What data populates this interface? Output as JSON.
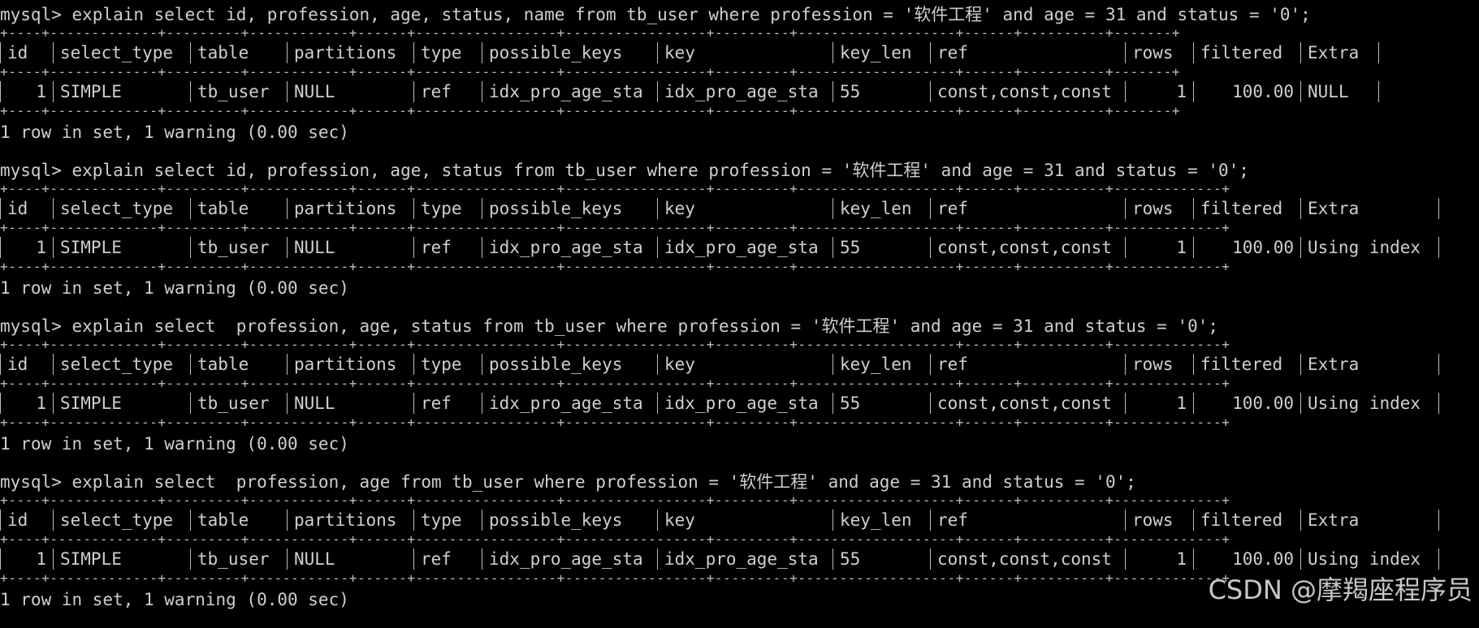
{
  "queries": [
    {
      "command": "mysql> explain select id, profession, age, status, name from tb_user where profession = '软件工程' and age = 31 and status = '0';",
      "headers": [
        "id",
        "select_type",
        "table",
        "partitions",
        "type",
        "possible_keys",
        "key",
        "key_len",
        "ref",
        "rows",
        "filtered",
        "Extra"
      ],
      "row": [
        "1",
        "SIMPLE",
        "tb_user",
        "NULL",
        "ref",
        "idx_pro_age_sta",
        "idx_pro_age_sta",
        "55",
        "const,const,const",
        "1",
        "100.00",
        "NULL"
      ],
      "status": "1 row in set, 1 warning (0.00 sec)"
    },
    {
      "command": "mysql> explain select id, profession, age, status from tb_user where profession = '软件工程' and age = 31 and status = '0';",
      "headers": [
        "id",
        "select_type",
        "table",
        "partitions",
        "type",
        "possible_keys",
        "key",
        "key_len",
        "ref",
        "rows",
        "filtered",
        "Extra"
      ],
      "row": [
        "1",
        "SIMPLE",
        "tb_user",
        "NULL",
        "ref",
        "idx_pro_age_sta",
        "idx_pro_age_sta",
        "55",
        "const,const,const",
        "1",
        "100.00",
        "Using index"
      ],
      "status": "1 row in set, 1 warning (0.00 sec)"
    },
    {
      "command": "mysql> explain select  profession, age, status from tb_user where profession = '软件工程' and age = 31 and status = '0';",
      "headers": [
        "id",
        "select_type",
        "table",
        "partitions",
        "type",
        "possible_keys",
        "key",
        "key_len",
        "ref",
        "rows",
        "filtered",
        "Extra"
      ],
      "row": [
        "1",
        "SIMPLE",
        "tb_user",
        "NULL",
        "ref",
        "idx_pro_age_sta",
        "idx_pro_age_sta",
        "55",
        "const,const,const",
        "1",
        "100.00",
        "Using index"
      ],
      "status": "1 row in set, 1 warning (0.00 sec)"
    },
    {
      "command": "mysql> explain select  profession, age from tb_user where profession = '软件工程' and age = 31 and status = '0';",
      "headers": [
        "id",
        "select_type",
        "table",
        "partitions",
        "type",
        "possible_keys",
        "key",
        "key_len",
        "ref",
        "rows",
        "filtered",
        "Extra"
      ],
      "row": [
        "1",
        "SIMPLE",
        "tb_user",
        "NULL",
        "ref",
        "idx_pro_age_sta",
        "idx_pro_age_sta",
        "55",
        "const,const,const",
        "1",
        "100.00",
        "Using index"
      ],
      "status": "1 row in set, 1 warning (0.00 sec)"
    }
  ],
  "watermark": "CSDN @摩羯座程序员",
  "colors": {
    "background": "#000000",
    "text": "#cfcfcf",
    "border": "#bdbdbd"
  }
}
